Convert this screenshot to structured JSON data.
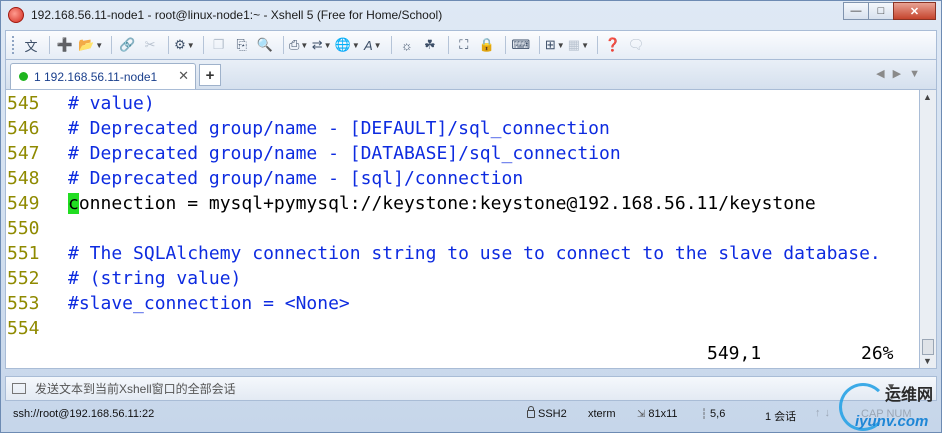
{
  "window": {
    "title": "192.168.56.11-node1 - root@linux-node1:~ - Xshell 5 (Free for Home/School)",
    "controls": {
      "minimize": "—",
      "maximize": "□",
      "close": "✕"
    }
  },
  "toolbar": {
    "icons": [
      "text-icon",
      "new-session-icon",
      "open-folder-icon",
      "reconnect-icon",
      "disconnect-icon",
      "properties-icon",
      "copy-icon",
      "paste-icon",
      "find-icon",
      "print-icon",
      "transfer-icon",
      "globe-icon",
      "font-icon",
      "xftp-icon",
      "xmanager-icon",
      "fullscreen-icon",
      "lock-icon",
      "keyboard-icon",
      "new-tab-icon",
      "layout-icon",
      "help-icon",
      "chat-icon"
    ],
    "text_button_label": "文"
  },
  "tabs": [
    {
      "label": "1 192.168.56.11-node1",
      "status_color": "#1fb51f"
    }
  ],
  "tab_add_label": "+",
  "terminal": {
    "lines": [
      {
        "num": "545",
        "text": "# value)",
        "type": "comment"
      },
      {
        "num": "546",
        "text": "# Deprecated group/name - [DEFAULT]/sql_connection",
        "type": "comment"
      },
      {
        "num": "547",
        "text": "# Deprecated group/name - [DATABASE]/sql_connection",
        "type": "comment"
      },
      {
        "num": "548",
        "text": "# Deprecated group/name - [sql]/connection",
        "type": "comment"
      },
      {
        "num": "549",
        "cursor_char": "c",
        "text": "onnection = mysql+pymysql://keystone:keystone@192.168.56.11/keystone",
        "type": "code"
      },
      {
        "num": "550",
        "text": "",
        "type": "code"
      },
      {
        "num": "551",
        "text": "# The SQLAlchemy connection string to use to connect to the slave database.",
        "type": "comment"
      },
      {
        "num": "552",
        "text": "# (string value)",
        "type": "comment"
      },
      {
        "num": "553",
        "text": "#slave_connection = <None>",
        "type": "comment"
      },
      {
        "num": "554",
        "text": "",
        "type": "code"
      }
    ],
    "position": "549,1",
    "percent": "26%",
    "colors": {
      "comment": "#0d2be0",
      "line_number": "#8f8a00",
      "cursor": "#22dd22"
    }
  },
  "compose_bar": {
    "placeholder": "发送文本到当前Xshell窗口的全部会话"
  },
  "status_bar": {
    "connection": "ssh://root@192.168.56.11:22",
    "protocol": "SSH2",
    "terminal_type": "xterm",
    "size": "81x11",
    "cursor": "5,6",
    "sessions": "1 会话",
    "caps": "CAP NUM"
  },
  "watermark": {
    "cn": "运维网",
    "en": "iyunv.com"
  }
}
